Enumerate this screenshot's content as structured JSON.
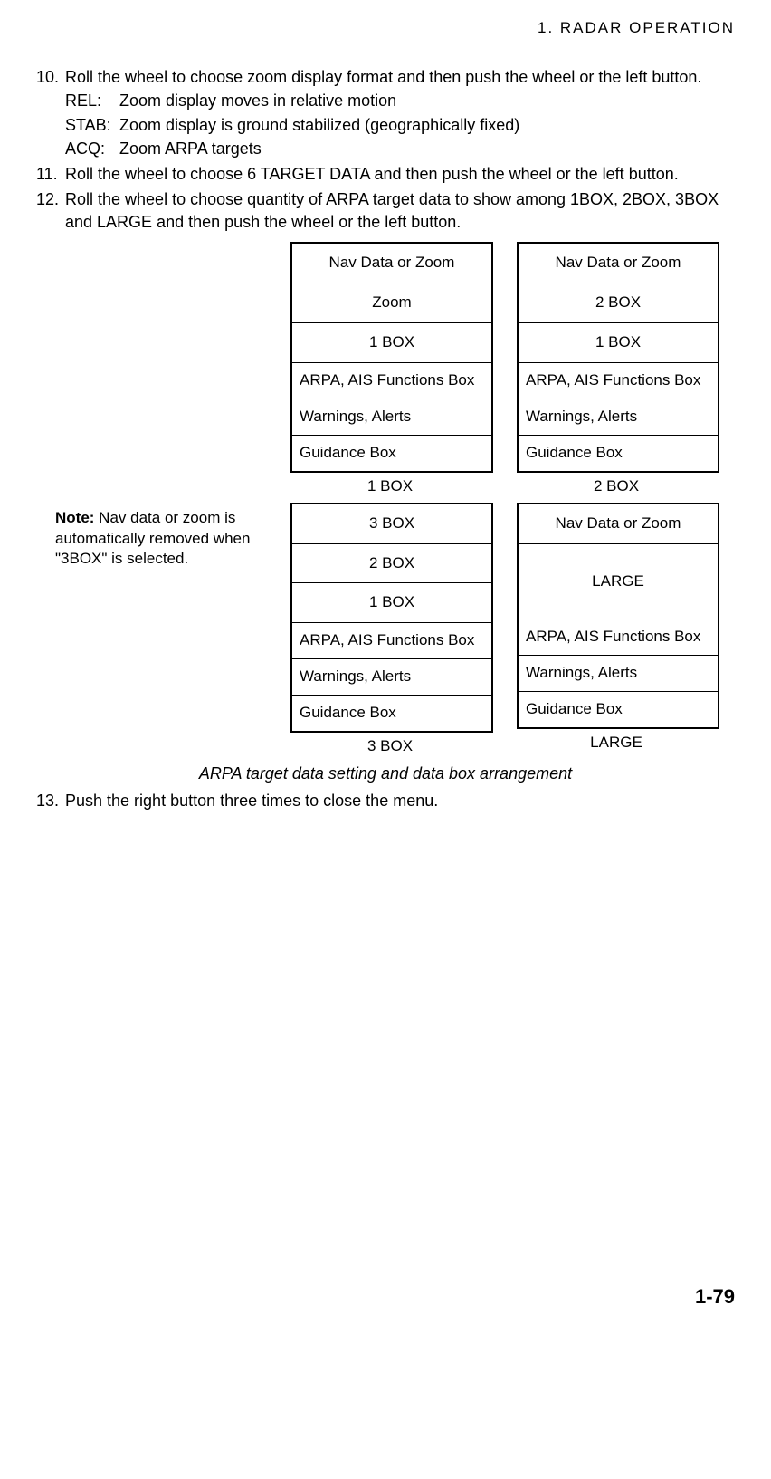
{
  "header": "1.  RADAR  OPERATION",
  "steps": {
    "s10": {
      "num": "10.",
      "text": "Roll the wheel to choose zoom display format and then push the wheel or the left button.",
      "defs": [
        {
          "key": "REL:",
          "val": "Zoom display moves in relative motion"
        },
        {
          "key": "STAB:",
          "val": "Zoom display is ground stabilized (geographically fixed)"
        },
        {
          "key": "ACQ:",
          "val": "Zoom ARPA targets"
        }
      ]
    },
    "s11": {
      "num": "11.",
      "text": "Roll the wheel to choose 6 TARGET DATA and then push the wheel or the left button."
    },
    "s12": {
      "num": "12.",
      "text": "Roll the wheel to choose quantity of ARPA target data to show among 1BOX, 2BOX, 3BOX and LARGE and then push the wheel or the left button."
    },
    "s13": {
      "num": "13.",
      "text": "Push the right button three times to close the menu."
    }
  },
  "note": {
    "bold": "Note:",
    "rest": " Nav data or zoom is automatically removed when \"3BOX\" is selected."
  },
  "diagrams": {
    "d1": {
      "label": "1 BOX",
      "cells": [
        {
          "t": "Nav Data or Zoom",
          "cls": "center"
        },
        {
          "t": "Zoom",
          "cls": "center"
        },
        {
          "t": "1 BOX",
          "cls": "center"
        },
        {
          "t": "ARPA, AIS Functions Box",
          "cls": "left"
        },
        {
          "t": "Warnings, Alerts",
          "cls": "left"
        },
        {
          "t": "Guidance Box",
          "cls": "left"
        }
      ]
    },
    "d2": {
      "label": "2 BOX",
      "cells": [
        {
          "t": "Nav Data or Zoom",
          "cls": "center"
        },
        {
          "t": "2 BOX",
          "cls": "center"
        },
        {
          "t": "1 BOX",
          "cls": "center"
        },
        {
          "t": "ARPA, AIS Functions Box",
          "cls": "left"
        },
        {
          "t": "Warnings, Alerts",
          "cls": "left"
        },
        {
          "t": "Guidance Box",
          "cls": "left"
        }
      ]
    },
    "d3": {
      "label": "3 BOX",
      "cells": [
        {
          "t": "3 BOX",
          "cls": "center"
        },
        {
          "t": "2 BOX",
          "cls": "center"
        },
        {
          "t": "1 BOX",
          "cls": "center"
        },
        {
          "t": "ARPA, AIS Functions Box",
          "cls": "left"
        },
        {
          "t": "Warnings, Alerts",
          "cls": "left"
        },
        {
          "t": "Guidance Box",
          "cls": "left"
        }
      ]
    },
    "d4": {
      "label": "LARGE",
      "cells": [
        {
          "t": "Nav Data or Zoom",
          "cls": "center"
        },
        {
          "t": "LARGE",
          "cls": "tall"
        },
        {
          "t": "ARPA, AIS Functions Box",
          "cls": "left"
        },
        {
          "t": "Warnings, Alerts",
          "cls": "left"
        },
        {
          "t": "Guidance Box",
          "cls": "left"
        }
      ]
    }
  },
  "caption": "ARPA target data setting and data box arrangement",
  "pageNum": "1-79"
}
